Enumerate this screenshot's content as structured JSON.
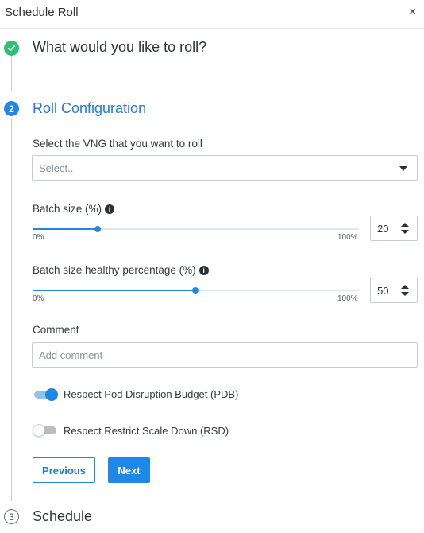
{
  "header": {
    "title": "Schedule Roll",
    "close_label": "×"
  },
  "steps": [
    {
      "number": "1",
      "title": "What would you like to roll?",
      "status": "done"
    },
    {
      "number": "2",
      "title": "Roll Configuration",
      "status": "active"
    },
    {
      "number": "3",
      "title": "Schedule",
      "status": "pending"
    }
  ],
  "form": {
    "vng": {
      "label": "Select the VNG that you want to roll",
      "placeholder": "Select.."
    },
    "batch_size": {
      "label": "Batch size (%)",
      "info_icon": "i",
      "value": "20",
      "value_fraction": 0.2,
      "min_label": "0%",
      "max_label": "100%"
    },
    "batch_healthy": {
      "label": "Batch size healthy percentage (%)",
      "info_icon": "i",
      "value": "50",
      "value_fraction": 0.5,
      "min_label": "0%",
      "max_label": "100%"
    },
    "comment": {
      "label": "Comment",
      "placeholder": "Add comment"
    },
    "pdb_toggle": {
      "label": "Respect Pod Disruption Budget (PDB)",
      "on": true
    },
    "rsd_toggle": {
      "label": "Respect Restrict Scale Down (RSD)",
      "on": false
    }
  },
  "buttons": {
    "previous": "Previous",
    "next": "Next"
  },
  "colors": {
    "accent": "#1f87e5",
    "success": "#2fbf71"
  },
  "icons": {
    "done_step": "check-icon",
    "close": "close-icon",
    "info": "info-icon",
    "dropdown": "caret-down-icon",
    "stepper": "stepper-arrows-icon"
  }
}
